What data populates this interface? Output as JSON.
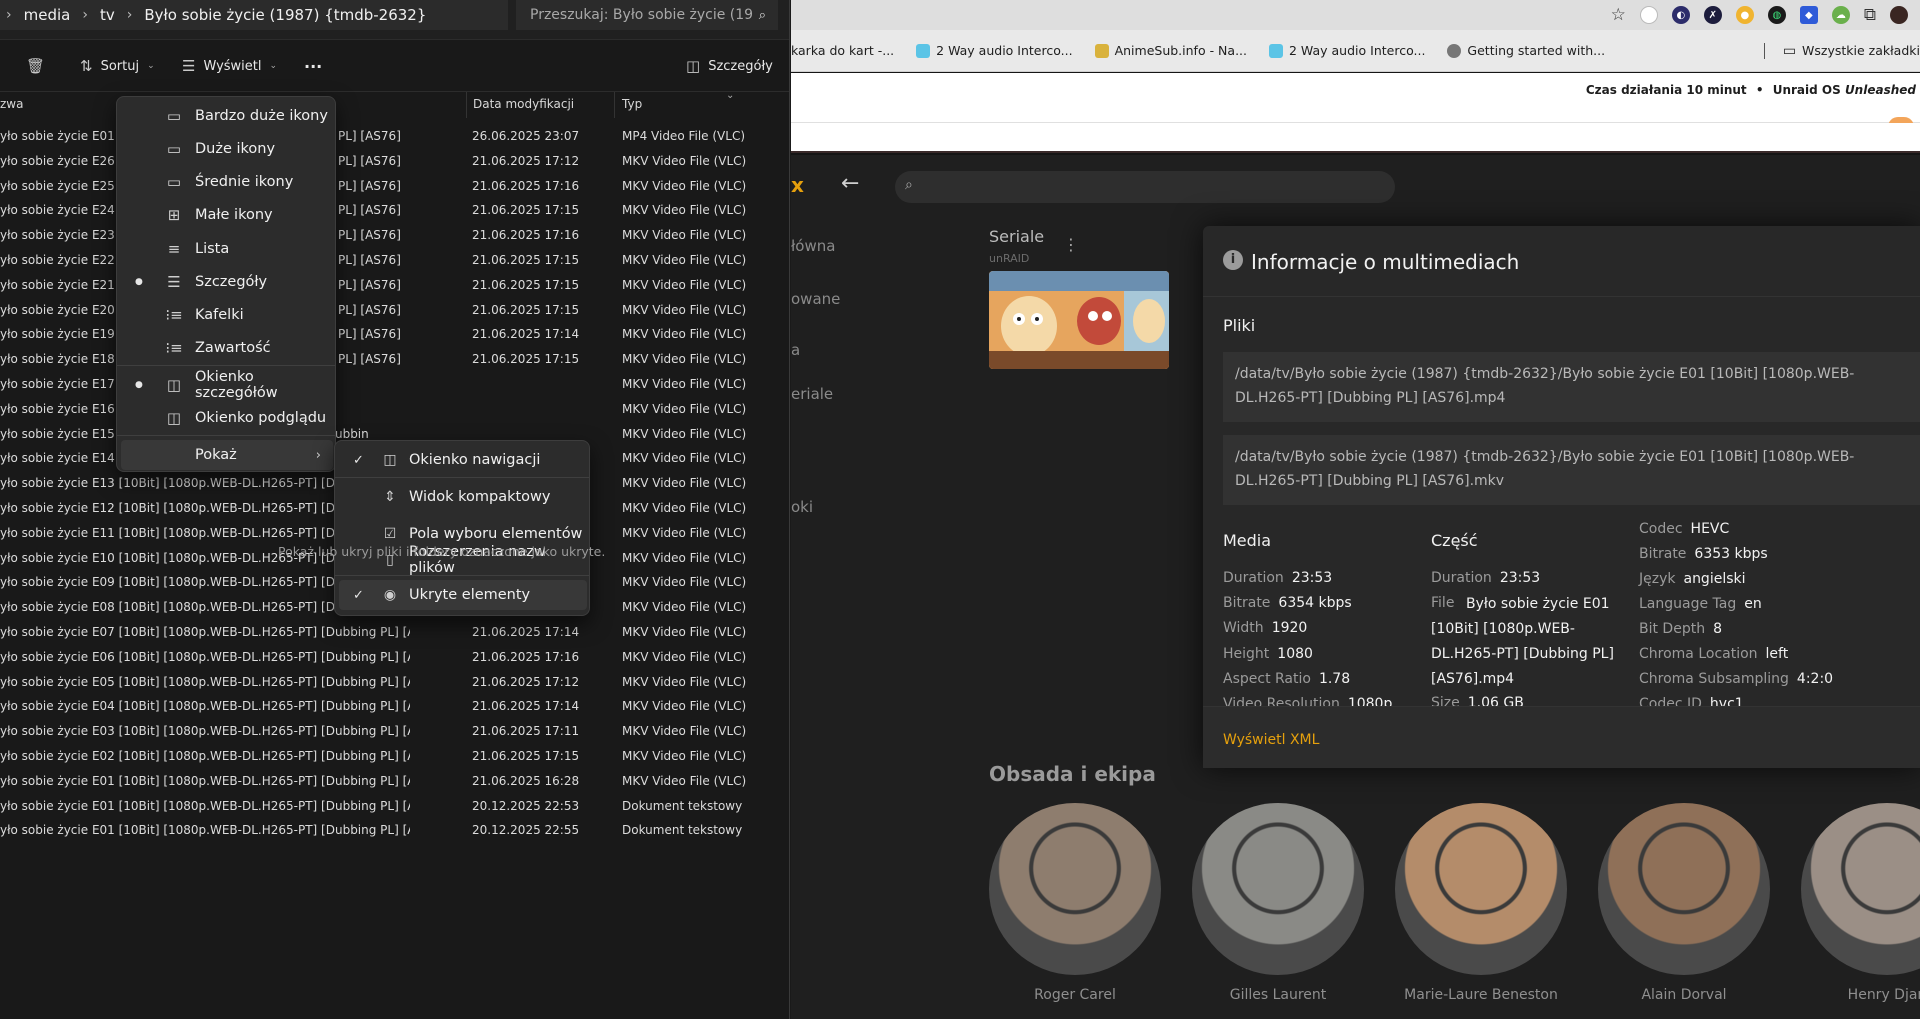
{
  "explorer": {
    "path": [
      "media",
      "tv",
      "Było sobie życie (1987) {tmdb-2632}"
    ],
    "search_placeholder": "Przeszukaj: Było sobie życie (19",
    "toolbar": {
      "sort_label": "Sortuj",
      "view_label": "Wyświetl",
      "more_label": "···",
      "details_label": "Szczegóły"
    },
    "columns": {
      "name": "zwa",
      "date": "Data modyfikacji",
      "type": "Typ"
    },
    "rows": [
      {
        "name": "yło sobie życie E01 [1",
        "tail": "PL] [AS76]",
        "date": "26.06.2025 23:07",
        "type": "MP4 Video File (VLC)"
      },
      {
        "name": "yło sobie życie E26 [1",
        "tail": "PL] [AS76]",
        "date": "21.06.2025 17:12",
        "type": "MKV Video File (VLC)"
      },
      {
        "name": "yło sobie życie E25 [1",
        "tail": "PL] [AS76]",
        "date": "21.06.2025 17:16",
        "type": "MKV Video File (VLC)"
      },
      {
        "name": "yło sobie życie E24 [1",
        "tail": "PL] [AS76]",
        "date": "21.06.2025 17:15",
        "type": "MKV Video File (VLC)"
      },
      {
        "name": "yło sobie życie E23 [1",
        "tail": "PL] [AS76]",
        "date": "21.06.2025 17:16",
        "type": "MKV Video File (VLC)"
      },
      {
        "name": "yło sobie życie E22 [1",
        "tail": "PL] [AS76]",
        "date": "21.06.2025 17:15",
        "type": "MKV Video File (VLC)"
      },
      {
        "name": "yło sobie życie E21 [1",
        "tail": "PL] [AS76]",
        "date": "21.06.2025 17:15",
        "type": "MKV Video File (VLC)"
      },
      {
        "name": "yło sobie życie E20 [1",
        "tail": "PL] [AS76]",
        "date": "21.06.2025 17:15",
        "type": "MKV Video File (VLC)"
      },
      {
        "name": "yło sobie życie E19 [1",
        "tail": "PL] [AS76]",
        "date": "21.06.2025 17:14",
        "type": "MKV Video File (VLC)"
      },
      {
        "name": "yło sobie życie E18 [1",
        "tail": "PL] [AS76]",
        "date": "21.06.2025 17:15",
        "type": "MKV Video File (VLC)"
      },
      {
        "name": "yło sobie życie E17 [1",
        "tail": "",
        "date": "",
        "type": "MKV Video File (VLC)"
      },
      {
        "name": "yło sobie życie E16 [1",
        "tail": "",
        "date": "",
        "type": "MKV Video File (VLC)"
      },
      {
        "name": "yło sobie życie E15 [10Bit] [1080p.WEB-DL.H265-PT] [Dubbin",
        "tail": "",
        "date": "",
        "type": "MKV Video File (VLC)"
      },
      {
        "name": "yło sobie życie E14 [10Bit] [1080p.WEB-DL.H265-PT] [Dubbin",
        "tail": "",
        "date": "",
        "type": "MKV Video File (VLC)"
      },
      {
        "name": "yło sobie życie E13 [10Bit] [1080p.WEB-DL.H265-PT] [Dubbin",
        "tail": "",
        "date": "",
        "type": "MKV Video File (VLC)"
      },
      {
        "name": "yło sobie życie E12 [10Bit] [1080p.WEB-DL.H265-PT] [Dubbin",
        "tail": "",
        "date": "",
        "type": "MKV Video File (VLC)"
      },
      {
        "name": "yło sobie życie E11 [10Bit] [1080p.WEB-DL.H265-PT] [Dubbing PL] [AS76]",
        "tail": "",
        "date": "21.06.2025 17:13",
        "type": "MKV Video File (VLC)"
      },
      {
        "name": "yło sobie życie E10 [10Bit] [1080p.WEB-DL.H265-PT] [Dubbing PL] [AS76]",
        "tail": "",
        "date": "21.06.2025 17:16",
        "type": "MKV Video File (VLC)"
      },
      {
        "name": "yło sobie życie E09 [10Bit] [1080p.WEB-DL.H265-PT] [Dubbing PL] [AS76]",
        "tail": "",
        "date": "21.06.2025 17:16",
        "type": "MKV Video File (VLC)"
      },
      {
        "name": "yło sobie życie E08 [10Bit] [1080p.WEB-DL.H265-PT] [Dubbing PL] [AS76]",
        "tail": "",
        "date": "21.06.2025 17:16",
        "type": "MKV Video File (VLC)"
      },
      {
        "name": "yło sobie życie E07 [10Bit] [1080p.WEB-DL.H265-PT] [Dubbing PL] [AS76]",
        "tail": "",
        "date": "21.06.2025 17:14",
        "type": "MKV Video File (VLC)"
      },
      {
        "name": "yło sobie życie E06 [10Bit] [1080p.WEB-DL.H265-PT] [Dubbing PL] [AS76]",
        "tail": "",
        "date": "21.06.2025 17:16",
        "type": "MKV Video File (VLC)"
      },
      {
        "name": "yło sobie życie E05 [10Bit] [1080p.WEB-DL.H265-PT] [Dubbing PL] [AS76]",
        "tail": "",
        "date": "21.06.2025 17:12",
        "type": "MKV Video File (VLC)"
      },
      {
        "name": "yło sobie życie E04 [10Bit] [1080p.WEB-DL.H265-PT] [Dubbing PL] [AS76]",
        "tail": "",
        "date": "21.06.2025 17:14",
        "type": "MKV Video File (VLC)"
      },
      {
        "name": "yło sobie życie E03 [10Bit] [1080p.WEB-DL.H265-PT] [Dubbing PL] [AS76]",
        "tail": "",
        "date": "21.06.2025 17:11",
        "type": "MKV Video File (VLC)"
      },
      {
        "name": "yło sobie życie E02 [10Bit] [1080p.WEB-DL.H265-PT] [Dubbing PL] [AS76]",
        "tail": "",
        "date": "21.06.2025 17:15",
        "type": "MKV Video File (VLC)"
      },
      {
        "name": "yło sobie życie E01 [10Bit] [1080p.WEB-DL.H265-PT] [Dubbing PL] [AS76]",
        "tail": "",
        "date": "21.06.2025 16:28",
        "type": "MKV Video File (VLC)"
      },
      {
        "name": "yło sobie życie E01 [10Bit] [1080p.WEB-DL.H265-PT] [Dubbing PL] [AS76]",
        "tail": "",
        "date": "20.12.2025 22:53",
        "type": "Dokument tekstowy"
      },
      {
        "name": "yło sobie życie E01 [10Bit] [1080p.WEB-DL.H265-PT] [Dubbing PL] [AS76]",
        "tail": "",
        "date": "20.12.2025 22:55",
        "type": "Dokument tekstowy"
      }
    ],
    "view_menu": [
      {
        "label": "Bardzo duże ikony",
        "icon": "monitor-icon",
        "glyph": "▭",
        "bullet": false
      },
      {
        "label": "Duże ikony",
        "icon": "monitor-icon",
        "glyph": "▭",
        "bullet": false
      },
      {
        "label": "Średnie ikony",
        "icon": "monitor-icon",
        "glyph": "▭",
        "bullet": false
      },
      {
        "label": "Małe ikony",
        "icon": "grid-icon",
        "glyph": "⊞",
        "bullet": false
      },
      {
        "label": "Lista",
        "icon": "list-icon",
        "glyph": "≡",
        "bullet": false
      },
      {
        "label": "Szczegóły",
        "icon": "details-icon",
        "glyph": "☰",
        "bullet": true
      },
      {
        "label": "Kafelki",
        "icon": "tiles-icon",
        "glyph": "⁝≡",
        "bullet": false
      },
      {
        "label": "Zawartość",
        "icon": "content-icon",
        "glyph": "⁝≡",
        "bullet": false
      },
      {
        "label": "Okienko szczegółów",
        "icon": "details-pane-icon",
        "glyph": "◫",
        "bullet": true
      },
      {
        "label": "Okienko podglądu",
        "icon": "preview-pane-icon",
        "glyph": "◫",
        "bullet": false
      },
      {
        "label": "Pokaż",
        "icon": "",
        "glyph": "",
        "bullet": false
      }
    ],
    "show_submenu": [
      {
        "label": "Okienko nawigacji",
        "icon": "navigation-pane-icon",
        "glyph": "◫",
        "checked": true
      },
      {
        "label": "Widok kompaktowy",
        "icon": "compact-view-icon",
        "glyph": "⇕",
        "checked": false
      },
      {
        "label": "Pola wyboru elementów",
        "icon": "checkbox-icon",
        "glyph": "☑",
        "checked": false
      },
      {
        "label": "Rozszerzenia nazw plików",
        "icon": "file-icon",
        "glyph": "▯",
        "checked": false
      },
      {
        "label": "Ukryte elementy",
        "icon": "eye-icon",
        "glyph": "◉",
        "checked": true
      }
    ],
    "tooltip": "Pokaż lub ukryj pliki i foldery oznaczone jako ukryte."
  },
  "browser": {
    "bookmarks": [
      {
        "label": "karka do kart -...",
        "color": "#5a8fd8"
      },
      {
        "label": "2 Way audio Interco...",
        "color": "#5bc4e6"
      },
      {
        "label": "AnimeSub.info - Na...",
        "color": "#d9b23c"
      },
      {
        "label": "2 Way audio Interco...",
        "color": "#5bc4e6"
      },
      {
        "label": "Getting started with...",
        "color": "#777777"
      }
    ],
    "all_bookmarks": "Wszystkie zakładki",
    "status_text": "Czas działania 10 minut",
    "status_sep": "•",
    "os_text": "Unraid OS ",
    "os_edition": "Unleashed"
  },
  "plex": {
    "logo_fragment": "x",
    "nav": [
      "łówna",
      "owane",
      "a",
      "eriale",
      "oki"
    ],
    "section_title": "Seriale",
    "section_sub": "unRAID",
    "cast_title": "Obsada i ekipa",
    "cast": [
      {
        "name": "Roger Carel",
        "tone": "#8e7d6e"
      },
      {
        "name": "Gilles Laurent",
        "tone": "#8a8a86"
      },
      {
        "name": "Marie-Laure Beneston",
        "tone": "#b48c6a"
      },
      {
        "name": "Alain Dorval",
        "tone": "#8f7058"
      },
      {
        "name": "Henry Djan",
        "tone": "#9b8f86"
      }
    ]
  },
  "media_info": {
    "title": "Informacje o multimediach",
    "files_label": "Pliki",
    "files": [
      "/data/tv/Było sobie życie (1987) {tmdb-2632}/Było sobie życie E01 [10Bit] [1080p.WEB-DL.H265-PT] [Dubbing PL] [AS76].mp4",
      "/data/tv/Było sobie życie (1987) {tmdb-2632}/Było sobie życie E01 [10Bit] [1080p.WEB-DL.H265-PT] [Dubbing PL] [AS76].mkv"
    ],
    "media_heading": "Media",
    "part_heading": "Część",
    "media": [
      {
        "k": "Duration",
        "v": "23:53"
      },
      {
        "k": "Bitrate",
        "v": "6354 kbps"
      },
      {
        "k": "Width",
        "v": "1920"
      },
      {
        "k": "Height",
        "v": "1080"
      },
      {
        "k": "Aspect Ratio",
        "v": "1.78"
      },
      {
        "k": "Video Resolution",
        "v": "1080p"
      }
    ],
    "part": {
      "duration_k": "Duration",
      "duration_v": "23:53",
      "file_k": "File",
      "file_v": [
        "Było sobie życie E01",
        "[10Bit] [1080p.WEB-",
        "DL.H265-PT] [Dubbing PL]",
        "[AS76].mp4"
      ],
      "size_k": "Size",
      "size_v": "1.06 GB"
    },
    "stream": [
      {
        "k": "Codec",
        "v": "HEVC"
      },
      {
        "k": "Bitrate",
        "v": "6353 kbps"
      },
      {
        "k": "Język",
        "v": "angielski"
      },
      {
        "k": "Language Tag",
        "v": "en"
      },
      {
        "k": "Bit Depth",
        "v": "8"
      },
      {
        "k": "Chroma Location",
        "v": "left"
      },
      {
        "k": "Chroma Subsampling",
        "v": "4:2:0"
      },
      {
        "k": "Codec ID",
        "v": "hvc1"
      }
    ],
    "xml_link": "Wyświetl XML"
  }
}
